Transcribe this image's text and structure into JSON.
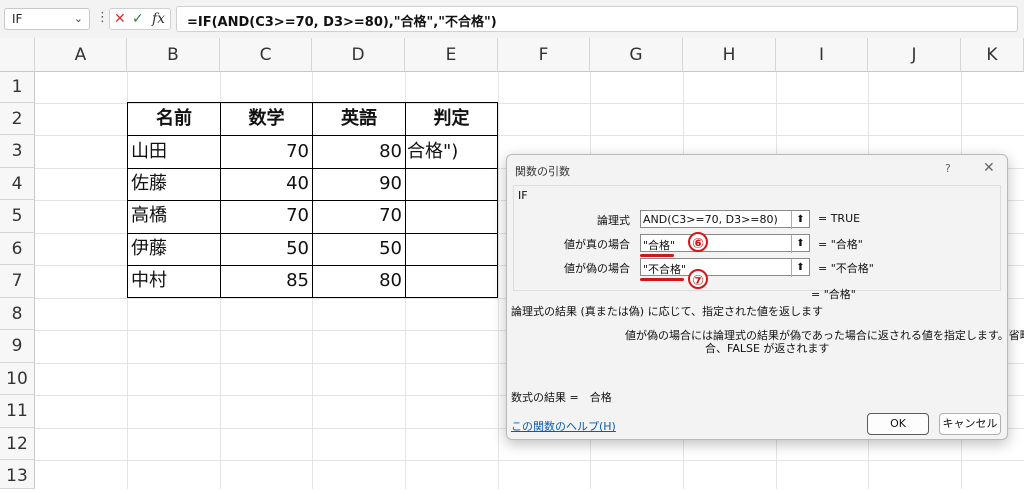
{
  "formula_bar": {
    "name_box": "IF",
    "name_dropdown": "⌄",
    "more": "⋮",
    "cancel": "✕",
    "enter": "✓",
    "fx": "fx",
    "formula": "=IF(AND(C3>=70, D3>=80),\"合格\",\"不合格\")"
  },
  "sheet": {
    "columns": [
      "A",
      "B",
      "C",
      "D",
      "E",
      "F",
      "G",
      "H",
      "I",
      "J",
      "K"
    ],
    "rows": [
      "1",
      "2",
      "3",
      "4",
      "5",
      "6",
      "7",
      "8",
      "9",
      "10",
      "11",
      "12",
      "13"
    ],
    "table": {
      "headers": [
        "名前",
        "数学",
        "英語",
        "判定"
      ],
      "rows": [
        {
          "name": "山田",
          "math": "70",
          "eng": "80",
          "judge": "合格\")"
        },
        {
          "name": "佐藤",
          "math": "40",
          "eng": "90",
          "judge": ""
        },
        {
          "name": "高橋",
          "math": "70",
          "eng": "70",
          "judge": ""
        },
        {
          "name": "伊藤",
          "math": "50",
          "eng": "50",
          "judge": ""
        },
        {
          "name": "中村",
          "math": "85",
          "eng": "80",
          "judge": ""
        }
      ]
    }
  },
  "dialog": {
    "title": "関数の引数",
    "help_q": "?",
    "close": "✕",
    "function": "IF",
    "args": [
      {
        "label": "論理式",
        "value": "AND(C3>=70, D3>=80)",
        "result": "= TRUE"
      },
      {
        "label": "値が真の場合",
        "value": "\"合格\"",
        "result": "= \"合格\""
      },
      {
        "label": "値が偽の場合",
        "value": "\"不合格\"",
        "result": "= \"不合格\""
      }
    ],
    "collapse_icon": "⬆",
    "overall_result": "= \"合格\"",
    "description": "論理式の結果 (真または偽) に応じて、指定された値を返します",
    "arg_desc_name": "値が偽の場合",
    "arg_desc_line1": "には論理式の結果が偽であった場合に返される値を指定します。省略された場",
    "arg_desc_line2": "合、FALSE が返されます",
    "formula_result": "数式の結果 =　合格",
    "help_link": "この関数のヘルプ(H)",
    "ok": "OK",
    "cancel": "キャンセル",
    "markers": [
      "⑥",
      "⑦"
    ]
  },
  "colors": {
    "marker": "#d01818",
    "link": "#0b5cb0"
  }
}
